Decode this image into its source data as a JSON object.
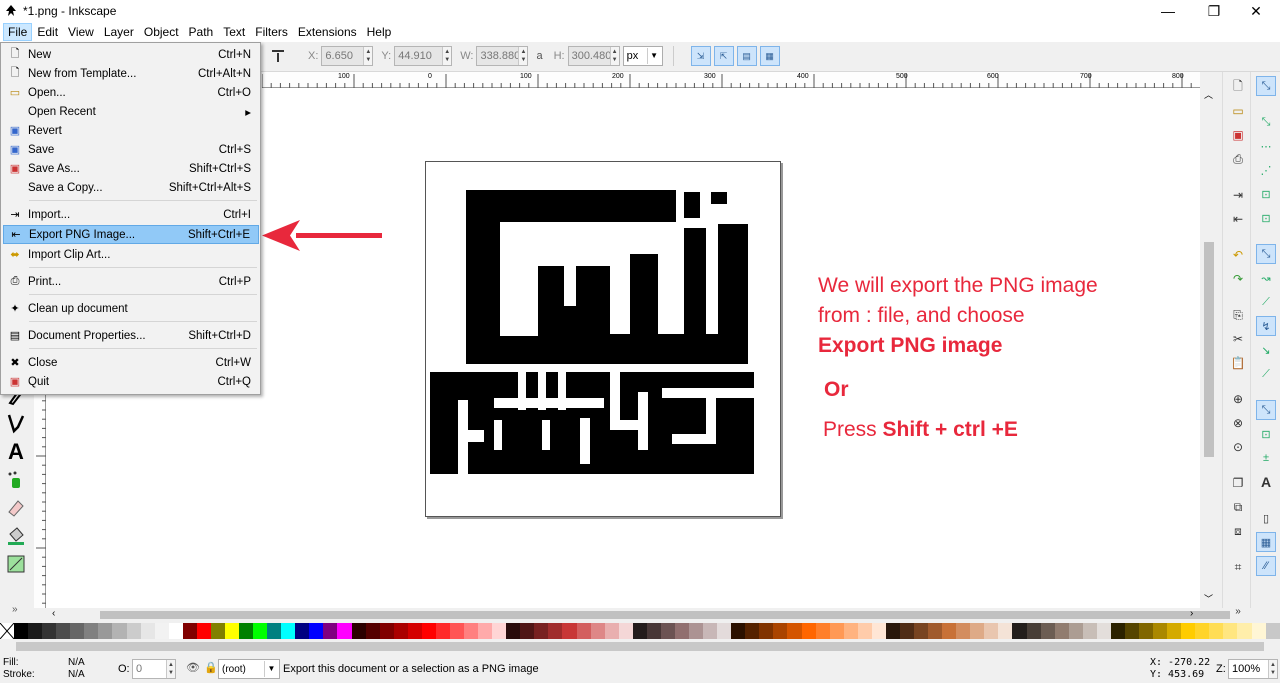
{
  "window": {
    "title": "*1.png - Inkscape",
    "minimize": "—",
    "restore": "❐",
    "close": "✕"
  },
  "menubar": [
    "File",
    "Edit",
    "View",
    "Layer",
    "Object",
    "Path",
    "Text",
    "Filters",
    "Extensions",
    "Help"
  ],
  "toolbar": {
    "x_label": "X:",
    "x_value": "6.650",
    "y_label": "Y:",
    "y_value": "44.910",
    "w_label": "W:",
    "w_value": "338.880",
    "lock": "a",
    "h_label": "H:",
    "h_value": "300.480",
    "unit": "px"
  },
  "ruler_ticks": [
    "100",
    "0",
    "100",
    "200",
    "300",
    "400",
    "500",
    "600",
    "700",
    "800"
  ],
  "file_menu": [
    {
      "label": "New",
      "shortcut": "Ctrl+N",
      "icon": "new-document-icon"
    },
    {
      "label": "New from Template...",
      "shortcut": "Ctrl+Alt+N",
      "icon": "template-icon"
    },
    {
      "label": "Open...",
      "shortcut": "Ctrl+O",
      "icon": "open-folder-icon"
    },
    {
      "label": "Open Recent",
      "shortcut": "▸",
      "icon": ""
    },
    {
      "label": "Revert",
      "shortcut": "",
      "icon": "revert-icon"
    },
    {
      "label": "Save",
      "shortcut": "Ctrl+S",
      "icon": "save-icon"
    },
    {
      "label": "Save As...",
      "shortcut": "Shift+Ctrl+S",
      "icon": "save-as-icon"
    },
    {
      "label": "Save a Copy...",
      "shortcut": "Shift+Ctrl+Alt+S",
      "icon": ""
    },
    {
      "label": "Import...",
      "shortcut": "Ctrl+I",
      "icon": "import-icon"
    },
    {
      "label": "Export PNG Image...",
      "shortcut": "Shift+Ctrl+E",
      "icon": "export-icon"
    },
    {
      "label": "Import Clip Art...",
      "shortcut": "",
      "icon": "clipart-icon"
    },
    {
      "label": "Print...",
      "shortcut": "Ctrl+P",
      "icon": "print-icon"
    },
    {
      "label": "Clean up document",
      "shortcut": "",
      "icon": "cleanup-icon"
    },
    {
      "label": "Document Properties...",
      "shortcut": "Shift+Ctrl+D",
      "icon": "properties-icon"
    },
    {
      "label": "Close",
      "shortcut": "Ctrl+W",
      "icon": "close-doc-icon"
    },
    {
      "label": "Quit",
      "shortcut": "Ctrl+Q",
      "icon": "quit-icon"
    }
  ],
  "annotation": {
    "line1": "We will export the PNG image",
    "line2": "from :  file, and choose",
    "line3": "Export PNG image",
    "line4": "Or",
    "line5_prefix": "Press ",
    "line5_bold": "Shift + ctrl +E"
  },
  "colors": {
    "annotation_red": "#e8283c",
    "arrow_red": "#e8283c",
    "menu_highlight": "#91c9f7"
  },
  "status": {
    "fill_label": "Fill:",
    "fill_value": "N/A",
    "stroke_label": "Stroke:",
    "stroke_value": "N/A",
    "opacity_label": "O:",
    "opacity_value": "0",
    "layer": "(root)",
    "message": "Export this document or a selection as a PNG image",
    "x_readout": "X: -270.22",
    "y_readout": "Y:  453.69",
    "zoom_label": "Z:",
    "zoom_value": "100%"
  }
}
